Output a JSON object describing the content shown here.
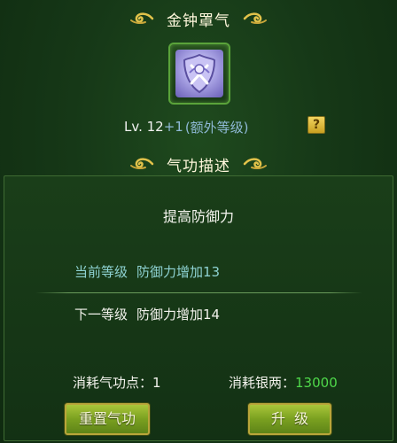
{
  "header": {
    "title": "金钟罩气"
  },
  "skill": {
    "level_main": "Lv. 12",
    "level_plus": "+1",
    "level_extra": "(额外等级)",
    "help_label": "?"
  },
  "section": {
    "title": "气功描述"
  },
  "description": {
    "effect_title": "提高防御力",
    "current_label": "当前等级",
    "current_value": "防御力增加13",
    "next_label": "下一等级",
    "next_value": "防御力增加14"
  },
  "costs": {
    "points_label": "消耗气功点：",
    "points_value": "1",
    "silver_label": "消耗银两：",
    "silver_value": "13000"
  },
  "buttons": {
    "reset_label": "重置气功",
    "upgrade_label": "升级"
  },
  "colors": {
    "background": "#163817",
    "accent_gold": "#e1c24a",
    "current_text": "#8ed2d2",
    "silver_value": "#4fd84a"
  }
}
